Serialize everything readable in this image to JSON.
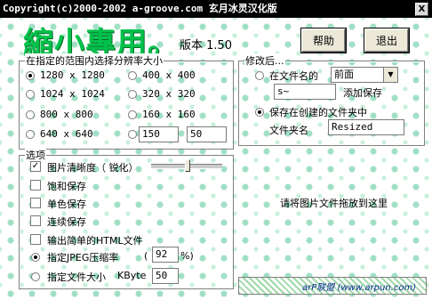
{
  "window": {
    "title": "Copyright(c)2000-2002 a-groove.com 玄月冰灵汉化版",
    "close_glyph": "X"
  },
  "logo": {
    "text": "縮小專用。",
    "version": "版本 1.50"
  },
  "buttons": {
    "help": "帮助",
    "exit": "退出"
  },
  "resolution": {
    "legend": "在指定的范围内选择分辨率大小",
    "options": [
      {
        "label": "1280 x 1280",
        "selected": true
      },
      {
        "label": "400 x 400",
        "selected": false
      },
      {
        "label": "1024 x 1024",
        "selected": false
      },
      {
        "label": "320 x 320",
        "selected": false
      },
      {
        "label": "800 x 800",
        "selected": false
      },
      {
        "label": "160 x 160",
        "selected": false
      },
      {
        "label": "640 x 640",
        "selected": false
      }
    ],
    "custom_width": "150",
    "custom_height": "50"
  },
  "modify": {
    "legend": "修改后...",
    "in_filename_label": "在文件名的",
    "position_select": "前面",
    "suffix_value": "s~",
    "add_save_label": "添加保存",
    "save_in_folder_label": "保存在创建的文件夹中",
    "folder_name_label": "文件夹名",
    "folder_name_value": "Resized"
  },
  "options": {
    "legend": "选项",
    "sharpness_label": "图片清晰度（ 锐化）",
    "saturated_label": "饱和保存",
    "mono_label": "单色保存",
    "continuous_label": "连续保存",
    "html_label": "输出简单的HTML文件",
    "jpeg_label": "指定JPEG压缩率",
    "jpeg_paren_open": "(",
    "jpeg_value": "92",
    "jpeg_paren_close": "%)",
    "filesize_label": "指定文件大小",
    "kbyte_label": "KByte",
    "filesize_value": "50"
  },
  "drop_hint": "请将图片文件拖放到这里",
  "credit": "arP联盟 (www.arpun.com)"
}
